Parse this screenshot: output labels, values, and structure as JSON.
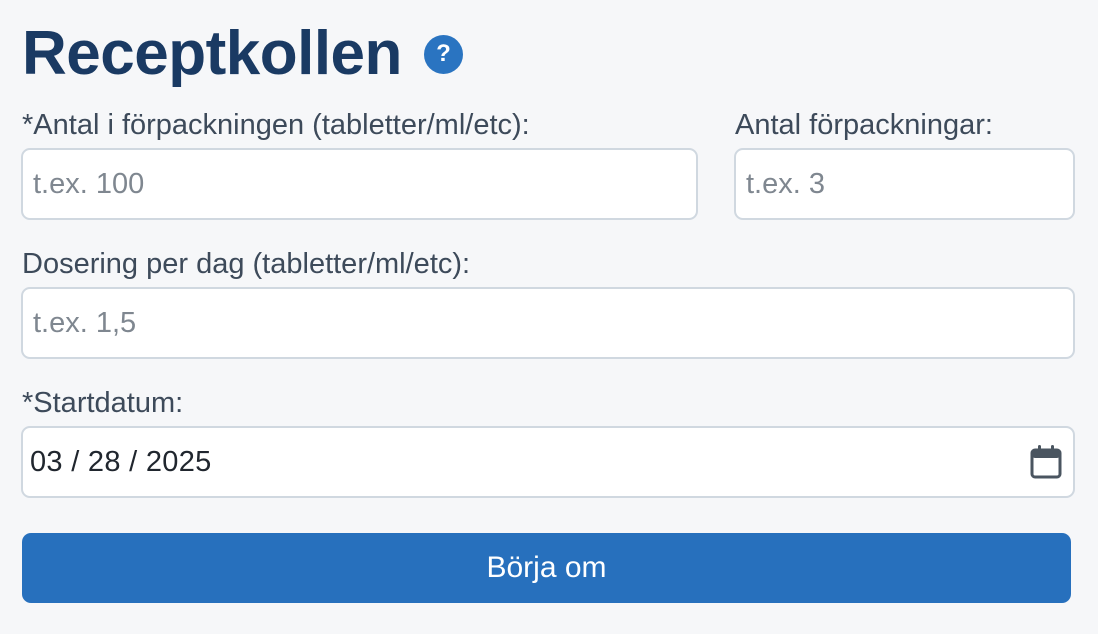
{
  "app": {
    "title": "Receptkollen",
    "help_icon_glyph": "?",
    "help_icon": "question-circle-icon"
  },
  "form": {
    "units_per_package": {
      "label": "*Antal i förpackningen (tabletter/ml/etc):",
      "value": "",
      "placeholder": "t.ex. 100"
    },
    "package_count": {
      "label": "Antal förpackningar:",
      "value": "",
      "placeholder": "t.ex. 3"
    },
    "daily_dose": {
      "label": "Dosering per dag (tabletter/ml/etc):",
      "value": "",
      "placeholder": "t.ex. 1,5"
    },
    "start_date": {
      "label": "*Startdatum:",
      "value": "03 / 28 / 2025",
      "icon": "calendar-icon"
    },
    "reset_button": {
      "label": "Börja om"
    }
  },
  "colors": {
    "background": "#f6f7f9",
    "title": "#1a3a63",
    "accent": "#2a74c1",
    "button": "#2770bd",
    "border": "#d0d8e0"
  }
}
